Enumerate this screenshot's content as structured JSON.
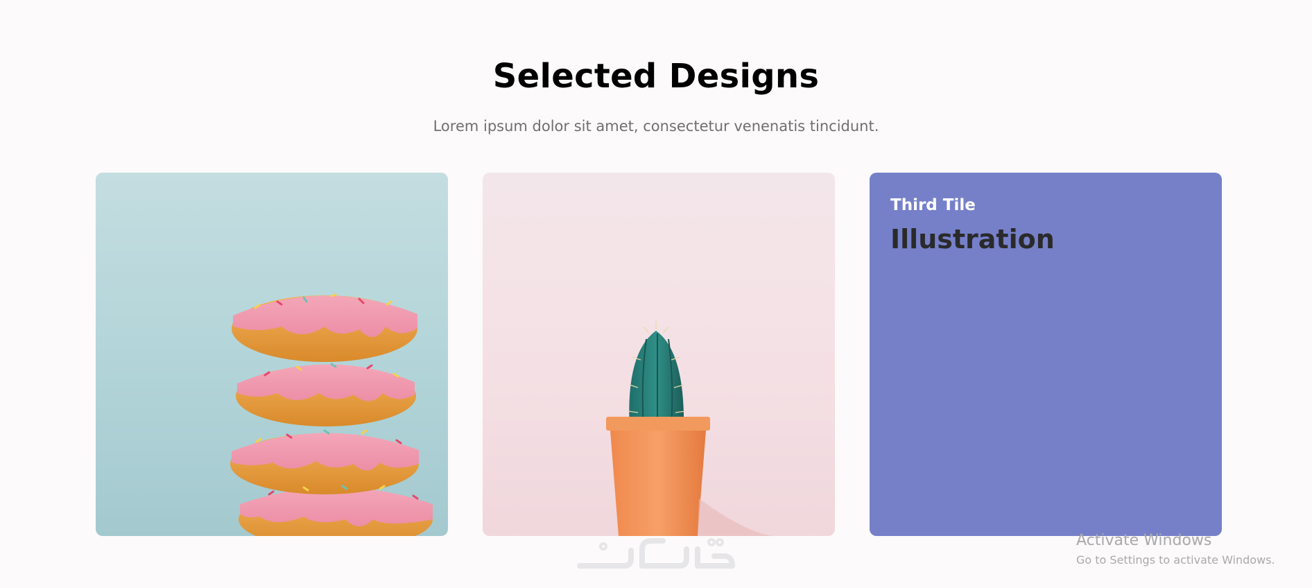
{
  "section": {
    "title": "Selected Designs",
    "subtitle": "Lorem ipsum dolor sit amet, consectetur venenatis tincidunt."
  },
  "tiles": [
    {
      "kind": "photo",
      "subject": "donuts-stack-image",
      "background": "#b3d5d9"
    },
    {
      "kind": "photo",
      "subject": "cactus-pot-image",
      "background": "#f3e2e6"
    },
    {
      "kind": "text",
      "kicker": "Third Tile",
      "heading": "Illustration",
      "background": "#7680c9"
    }
  ],
  "watermark": {
    "activate_title": "Activate Windows",
    "activate_sub": "Go to Settings to activate Windows."
  },
  "colors": {
    "page_bg": "#fcfafa",
    "title": "#000000",
    "subtitle": "#6f6f6f",
    "tile3_bg": "#7680c9",
    "tile3_kicker": "#ffffff",
    "tile3_heading": "#2a2a2a"
  }
}
